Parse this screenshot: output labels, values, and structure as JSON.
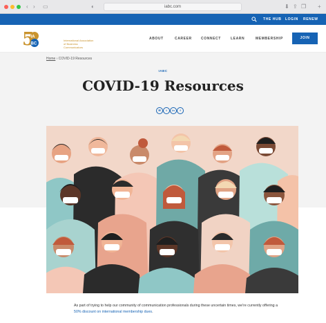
{
  "browser": {
    "url": "iabc.com"
  },
  "utility_nav": {
    "items": [
      "THE HUB",
      "LOGIN",
      "RENEW"
    ]
  },
  "header": {
    "logo_text_line1": "International Association",
    "logo_text_line2": "of Business Communicators",
    "logo_mark": "IABC",
    "nav": [
      "ABOUT",
      "CAREER",
      "CONNECT",
      "LEARN",
      "MEMBERSHIP"
    ],
    "join_label": "JOIN"
  },
  "breadcrumb": {
    "home": "Home",
    "separator": "›",
    "current": "COVID-19 Resources"
  },
  "page": {
    "eyebrow": "IABC",
    "title": "COVID-19 Resources",
    "share_icons": [
      "email-icon",
      "twitter-icon",
      "linkedin-icon",
      "facebook-icon"
    ],
    "share_glyphs": [
      "✉",
      "t",
      "in",
      "f"
    ]
  },
  "body": {
    "text_before": "As part of trying to help our community of communication professionals during these uncertain times, we're currently offering a ",
    "link_text": "50% discount on international membership dues",
    "text_after": "."
  },
  "colors": {
    "brand_blue": "#1663b4",
    "gold": "#c9932e",
    "band_gray": "#f3f3f3"
  }
}
